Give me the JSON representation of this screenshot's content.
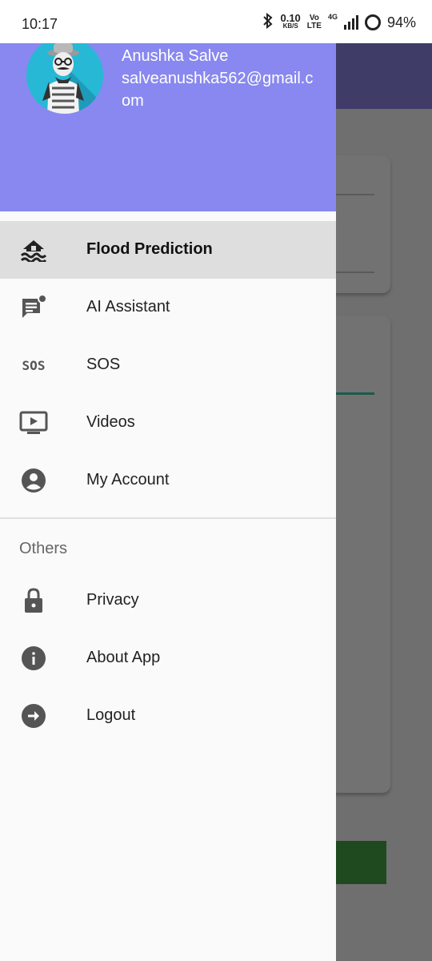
{
  "status_bar": {
    "time": "10:17",
    "net_speed_top": "0.10",
    "net_speed_unit": "KB/S",
    "volte_top": "Vo",
    "volte_bottom": "LTE",
    "network": "4G",
    "battery": "94%"
  },
  "drawer": {
    "user": {
      "name": "Anushka Salve",
      "email": "salveanushka562@gmail.com"
    },
    "menu": [
      {
        "label": "Flood Prediction",
        "icon": "flood-icon",
        "active": true
      },
      {
        "label": "AI Assistant",
        "icon": "chat-notification-icon",
        "active": false
      },
      {
        "label": "SOS",
        "icon": "sos-icon",
        "active": false
      },
      {
        "label": "Videos",
        "icon": "video-icon",
        "active": false
      },
      {
        "label": "My Account",
        "icon": "account-icon",
        "active": false
      }
    ],
    "others_title": "Others",
    "others": [
      {
        "label": "Privacy",
        "icon": "lock-icon"
      },
      {
        "label": "About App",
        "icon": "info-icon"
      },
      {
        "label": "Logout",
        "icon": "logout-icon"
      }
    ],
    "sos_glyph": "SOS"
  },
  "colors": {
    "drawer_header": "#8888f0",
    "active_item": "#dedede",
    "app_bar_dimmed": "#3f3c68",
    "primary_button_dimmed": "#1f4a20"
  }
}
